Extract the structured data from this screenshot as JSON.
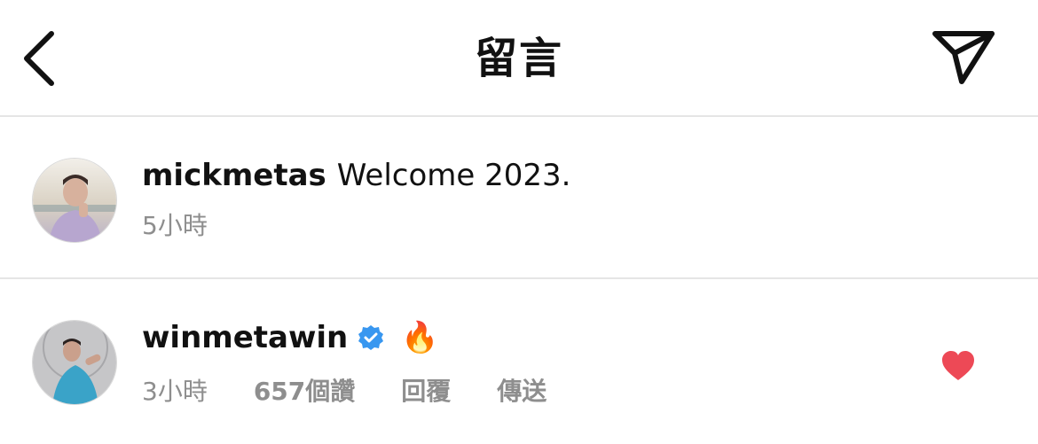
{
  "header": {
    "title": "留言",
    "back_icon": "chevron-left-icon",
    "send_icon": "paper-plane-icon"
  },
  "comments": [
    {
      "username": "mickmetas",
      "text": "Welcome 2023.",
      "time": "5小時",
      "verified": false
    },
    {
      "username": "winmetawin",
      "text": "🔥",
      "time": "3小時",
      "likes": "657個讚",
      "reply_label": "回覆",
      "send_label": "傳送",
      "verified": true,
      "liked": true
    }
  ],
  "colors": {
    "verified_blue": "#3897f0",
    "heart_red": "#ed4956",
    "meta_gray": "#8e8e8e",
    "divider": "#e5e5e5"
  }
}
